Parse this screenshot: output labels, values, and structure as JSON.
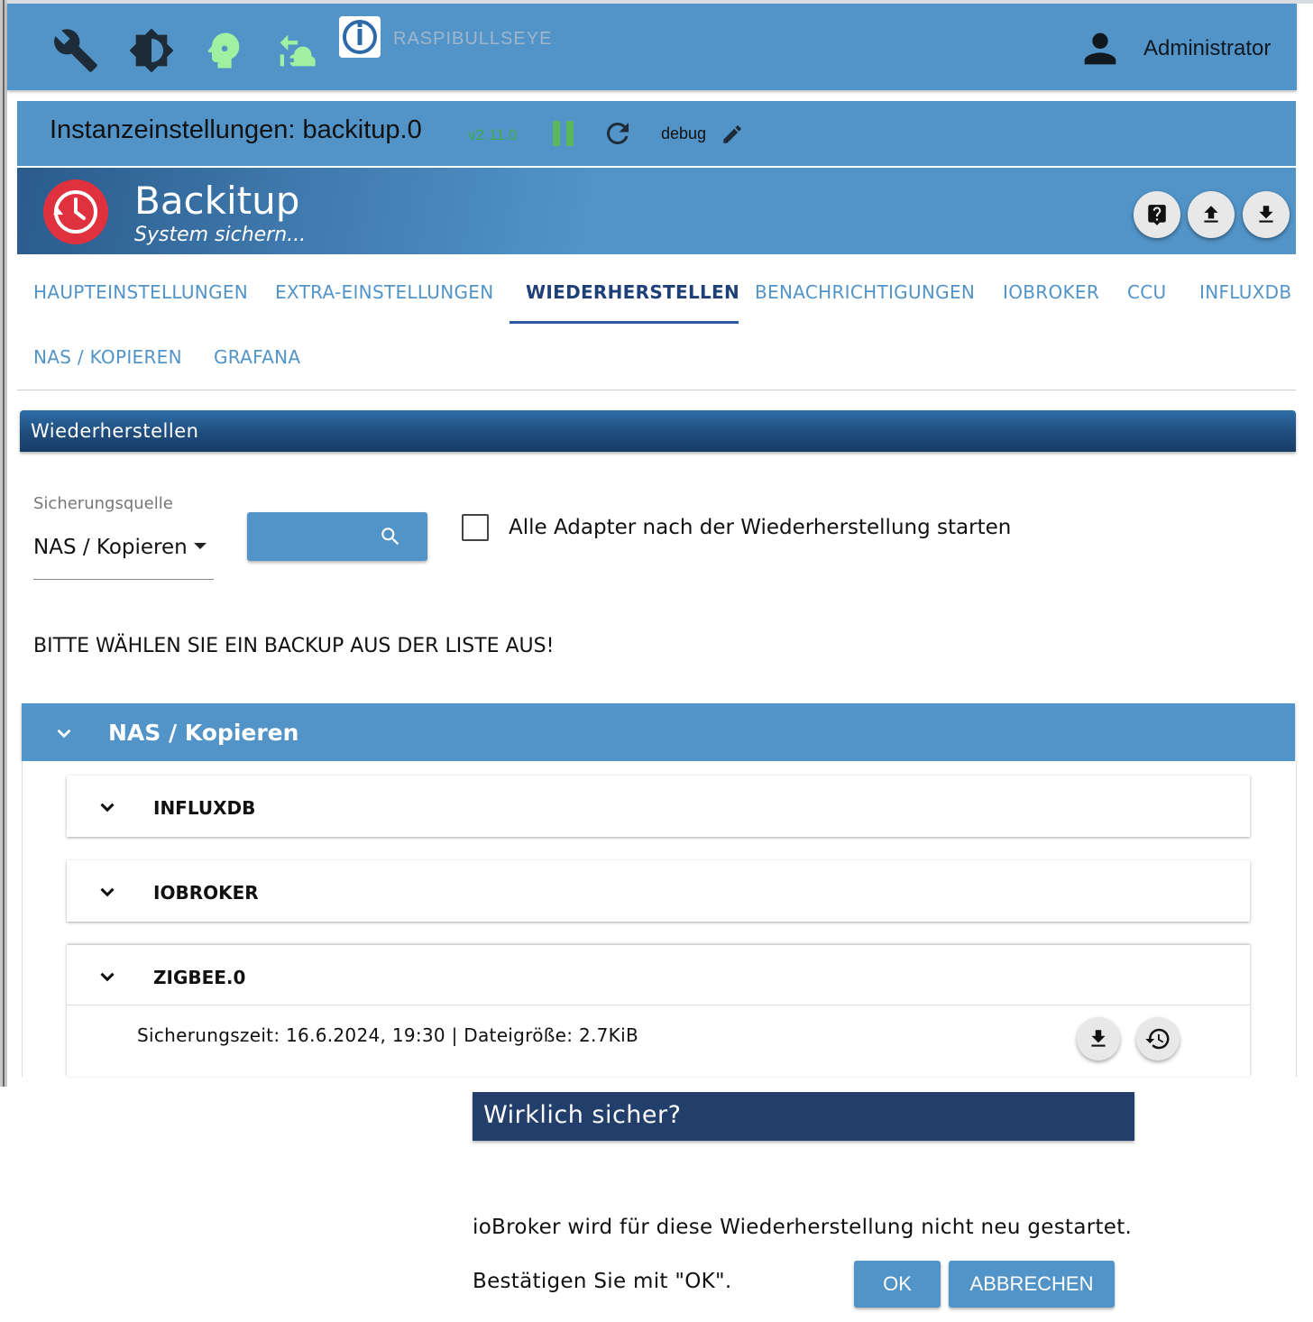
{
  "topbar": {
    "host": "RASPIBULLSEYE",
    "user": "Administrator",
    "icons": [
      "wrench-icon",
      "brightness-icon",
      "expert-mode-icon",
      "restart-icon",
      "iobroker-logo",
      "user-icon"
    ]
  },
  "instance": {
    "title": "Instanzeinstellungen: backitup.0",
    "version": "v2.11.0",
    "log_level": "debug"
  },
  "banner": {
    "title": "Backitup",
    "subtitle": "System sichern..."
  },
  "tabs": [
    {
      "label": "HAUPTEINSTELLUNGEN"
    },
    {
      "label": "EXTRA-EINSTELLUNGEN"
    },
    {
      "label": "WIEDERHERSTELLEN",
      "active": true
    },
    {
      "label": "BENACHRICHTIGUNGEN"
    },
    {
      "label": "IOBROKER"
    },
    {
      "label": "CCU"
    },
    {
      "label": "INFLUXDB"
    },
    {
      "label": "NAS / KOPIEREN"
    },
    {
      "label": "GRAFANA"
    }
  ],
  "section": {
    "title": "Wiederherstellen",
    "source_label": "Sicherungsquelle",
    "source_value": "NAS / Kopieren",
    "checkbox_label": "Alle Adapter nach der Wiederherstellung starten",
    "checkbox_checked": false,
    "instruction": "BITTE WÄHLEN SIE EIN BACKUP AUS DER LISTE AUS!"
  },
  "accordion": {
    "title": "NAS / Kopieren",
    "groups": [
      {
        "title": "INFLUXDB"
      },
      {
        "title": "IOBROKER"
      },
      {
        "title": "ZIGBEE.0",
        "entry": "Sicherungszeit: 16.6.2024, 19:30 | Dateigröße: 2.7KiB"
      }
    ]
  },
  "dialog": {
    "title": "Wirklich sicher?",
    "line1": "ioBroker wird für diese Wiederherstellung nicht neu gestartet.",
    "line2": "Bestätigen Sie mit \"OK\".",
    "ok": "OK",
    "cancel": "ABBRECHEN"
  },
  "colors": {
    "primary": "#5294c8",
    "dark_header": "#223f6b",
    "active_tab": "#1e3f78",
    "version_green": "#3faa4c",
    "logo_red": "#e0313f"
  }
}
